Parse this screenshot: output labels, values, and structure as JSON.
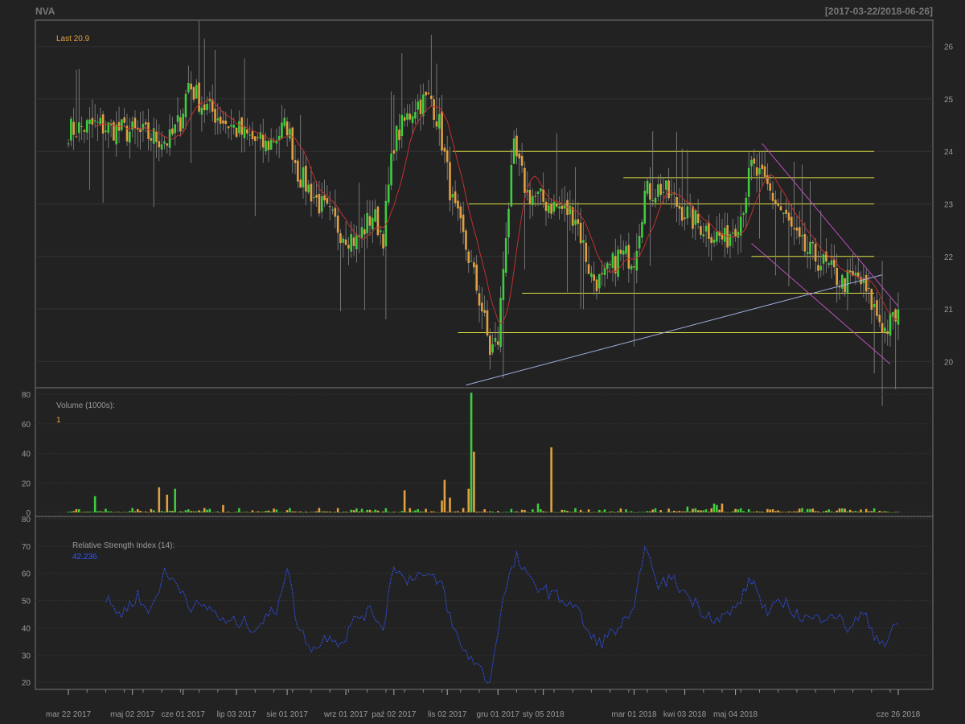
{
  "header": {
    "symbol": "NVA",
    "date_range": "[2017-03-22/2018-06-26]"
  },
  "colors": {
    "background": "#222222",
    "up": "#3fcc3f",
    "down": "#e0a040",
    "ma": "#c03030",
    "support": "#e0e040",
    "trend": "#a0b0e0",
    "channel": "#c050c0",
    "rsi": "#3355ff",
    "grid": "#333333",
    "frame": "#777777",
    "label": "#999999"
  },
  "chart_data": [
    {
      "type": "candlestick",
      "name": "price",
      "legend": {
        "label": "Last 20.9"
      },
      "yticks": [
        20,
        21,
        22,
        23,
        24,
        25,
        26
      ],
      "ylim": [
        19.5,
        26.5
      ],
      "horizontal_levels": [
        {
          "value": 24.0,
          "from_index": 144,
          "to_index": 302
        },
        {
          "value": 23.5,
          "from_index": 208,
          "to_index": 302
        },
        {
          "value": 23.0,
          "from_index": 150,
          "to_index": 302
        },
        {
          "value": 22.0,
          "from_index": 256,
          "to_index": 302
        },
        {
          "value": 21.3,
          "from_index": 170,
          "to_index": 302
        },
        {
          "value": 20.55,
          "from_index": 146,
          "to_index": 308
        }
      ],
      "trendlines": [
        {
          "kind": "support",
          "from": [
            149,
            19.55
          ],
          "to": [
            305,
            21.65
          ]
        },
        {
          "kind": "channel",
          "from": [
            260,
            24.15
          ],
          "to": [
            311,
            21.05
          ]
        },
        {
          "kind": "channel",
          "from": [
            256,
            22.25
          ],
          "to": [
            308,
            19.95
          ]
        }
      ],
      "description": "Daily OHLC candles, about 310 trading days, with a red moving average overlay"
    },
    {
      "type": "bar",
      "name": "volume",
      "legend": {
        "label": "Volume (1000s):",
        "value": "1"
      },
      "yticks": [
        0,
        20,
        40,
        60,
        80
      ],
      "ylim": [
        0,
        80
      ]
    },
    {
      "type": "line",
      "name": "rsi",
      "legend": {
        "label": "Relative Strength Index (14):",
        "value": "42.236"
      },
      "yticks": [
        20,
        30,
        40,
        50,
        60,
        70,
        80
      ],
      "ylim": [
        18,
        80
      ]
    }
  ],
  "x_axis": {
    "labels": [
      {
        "text": "mar 22 2017",
        "index": 0
      },
      {
        "text": "maj 02 2017",
        "index": 24
      },
      {
        "text": "cze 01 2017",
        "index": 43
      },
      {
        "text": "lip 03 2017",
        "index": 63
      },
      {
        "text": "sie 01 2017",
        "index": 82
      },
      {
        "text": "wrz 01 2017",
        "index": 104
      },
      {
        "text": "paź 02 2017",
        "index": 122
      },
      {
        "text": "lis 02 2017",
        "index": 142
      },
      {
        "text": "gru 01 2017",
        "index": 161
      },
      {
        "text": "sty 05 2018",
        "index": 178
      },
      {
        "text": "mar 01 2018",
        "index": 212
      },
      {
        "text": "kwi 03 2018",
        "index": 231
      },
      {
        "text": "maj 04 2018",
        "index": 250
      },
      {
        "text": "cze 26 2018",
        "index": 311
      }
    ],
    "n_points": 312
  }
}
